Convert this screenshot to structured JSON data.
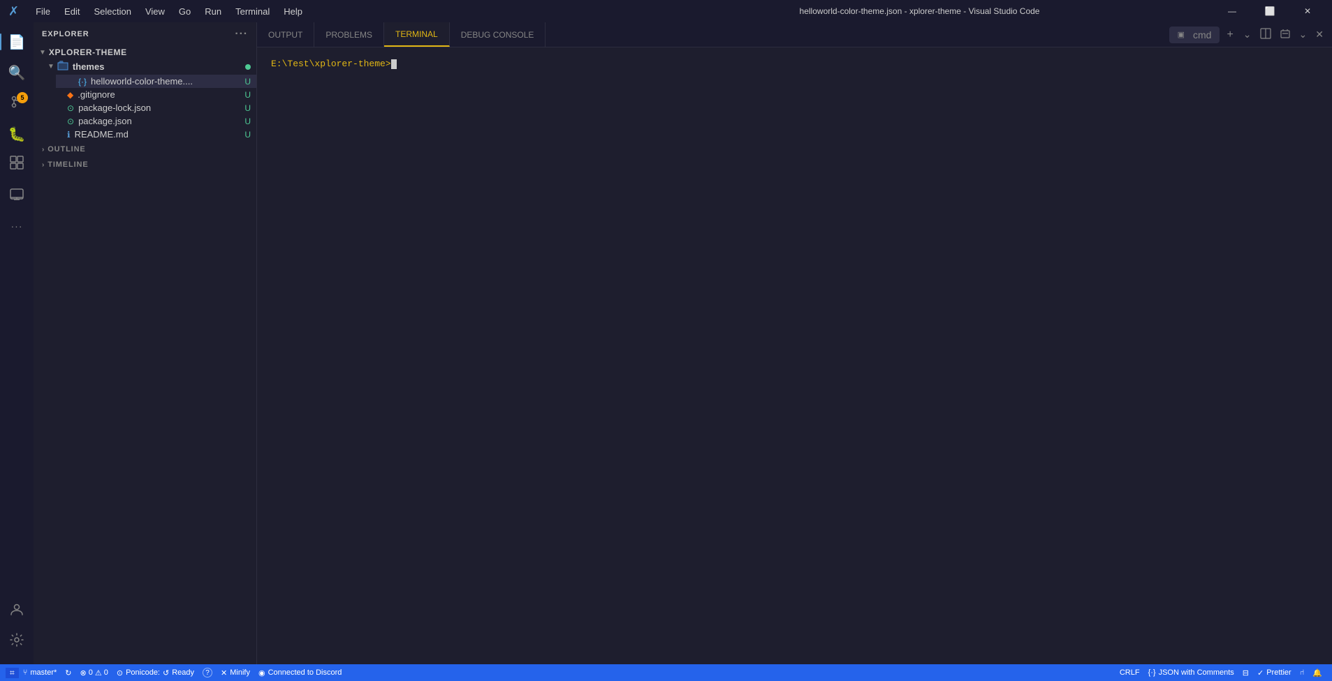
{
  "titlebar": {
    "icon": "✗",
    "menus": [
      "File",
      "Edit",
      "Selection",
      "View",
      "Go",
      "Run",
      "Terminal",
      "Help"
    ],
    "title": "helloworld-color-theme.json - xplorer-theme - Visual Studio Code",
    "minimize": "—",
    "restore": "⬜",
    "close": "✕"
  },
  "activitybar": {
    "items": [
      {
        "name": "explorer-icon",
        "icon": "🗋",
        "label": "Explorer",
        "active": true
      },
      {
        "name": "search-icon",
        "icon": "🔍",
        "label": "Search",
        "active": false
      },
      {
        "name": "source-control-icon",
        "icon": "⑂",
        "label": "Source Control",
        "active": false,
        "badge": "5"
      },
      {
        "name": "debug-icon",
        "icon": "🐛",
        "label": "Debug",
        "active": false
      },
      {
        "name": "extensions-icon",
        "icon": "⊞",
        "label": "Extensions",
        "active": false
      },
      {
        "name": "remote-icon",
        "icon": "🖥",
        "label": "Remote",
        "active": false
      },
      {
        "name": "more-icon",
        "icon": "···",
        "label": "More",
        "active": false
      }
    ],
    "bottom": [
      {
        "name": "account-icon",
        "icon": "👤",
        "label": "Account"
      },
      {
        "name": "settings-icon",
        "icon": "⚙",
        "label": "Settings"
      }
    ]
  },
  "sidebar": {
    "title": "EXPLORER",
    "more_icon": "···",
    "root": {
      "name": "XPLORER-THEME",
      "expanded": true
    },
    "folders": [
      {
        "name": "themes",
        "expanded": true,
        "has_dot": true,
        "files": [
          {
            "name": "helloworld-color-theme....",
            "icon": "{·}",
            "icon_color": "#4fc1ff",
            "status": "U",
            "active": true
          }
        ]
      }
    ],
    "files": [
      {
        "name": ".gitignore",
        "icon": "◆",
        "icon_color": "#f97316",
        "status": "U"
      },
      {
        "name": "package-lock.json",
        "icon": "⊙",
        "icon_color": "#4ec994",
        "status": "U"
      },
      {
        "name": "package.json",
        "icon": "⊙",
        "icon_color": "#4ec994",
        "status": "U"
      },
      {
        "name": "README.md",
        "icon": "ℹ",
        "icon_color": "#569cd6",
        "status": "U"
      }
    ],
    "outline_label": "OUTLINE",
    "timeline_label": "TIMELINE"
  },
  "terminal": {
    "tabs": [
      {
        "label": "OUTPUT",
        "active": false
      },
      {
        "label": "PROBLEMS",
        "active": false
      },
      {
        "label": "TERMINAL",
        "active": true
      },
      {
        "label": "DEBUG CONSOLE",
        "active": false
      }
    ],
    "cmd_label": "cmd",
    "prompt": "E:\\Test\\xplorer-theme>",
    "add_icon": "+",
    "split_icon": "⧉",
    "kill_icon": "🗑",
    "collapse_icon": "⌄",
    "close_icon": "✕"
  },
  "statusbar": {
    "git_icon": "⑂",
    "git_branch": "master*",
    "sync_icon": "↻",
    "error_icon": "⊗",
    "errors": "0",
    "warning_icon": "⚠",
    "warnings": "0",
    "ponicode_icon": "⊙",
    "ponicode_label": "Ponicode:",
    "ponicode_ready_icon": "↺",
    "ponicode_ready": "Ready",
    "help_icon": "?",
    "minify_icon": "✕",
    "minify_label": "Minify",
    "discord_icon": "◉",
    "discord_label": "Connected to Discord",
    "crlf_label": "CRLF",
    "json_icon": "{·}",
    "json_label": "JSON with Comments",
    "format_icon": "⊟",
    "prettier_icon": "✓",
    "prettier_label": "Prettier",
    "share_icon": "⑁",
    "bell_icon": "🔔",
    "remote_icon": "⌗",
    "remote_label": "Remote"
  }
}
